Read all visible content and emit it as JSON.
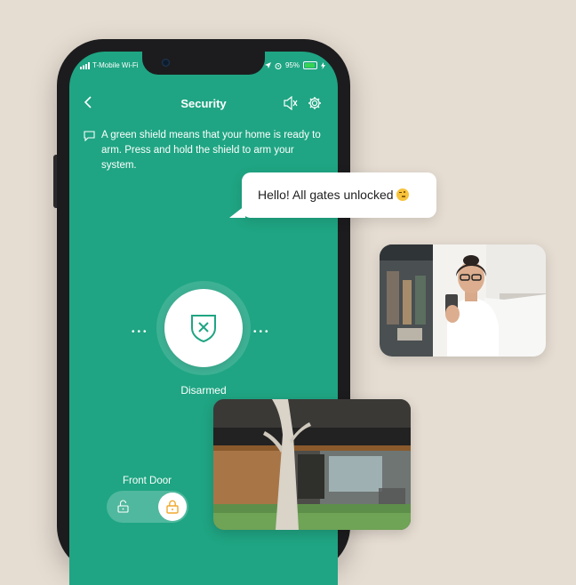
{
  "status": {
    "carrier": "T-Mobile Wi-Fi",
    "battery": "95%"
  },
  "nav": {
    "title": "Security"
  },
  "hint": {
    "text": "A green shield means that your home is ready to arm. Press and hold the shield to arm your system."
  },
  "security": {
    "state": "Disarmed"
  },
  "door": {
    "label": "Front Door"
  },
  "chat": {
    "message": "Hello! All gates unlocked"
  },
  "icons": [
    "back-icon",
    "speaker-icon",
    "settings-gear-icon",
    "message-icon",
    "shield-x-icon",
    "unlock-icon",
    "lock-icon",
    "wink-emoji-icon"
  ],
  "colors": {
    "primary": "#1fa583",
    "background": "#e6ddd2",
    "lock_accent": "#f0a92e"
  }
}
